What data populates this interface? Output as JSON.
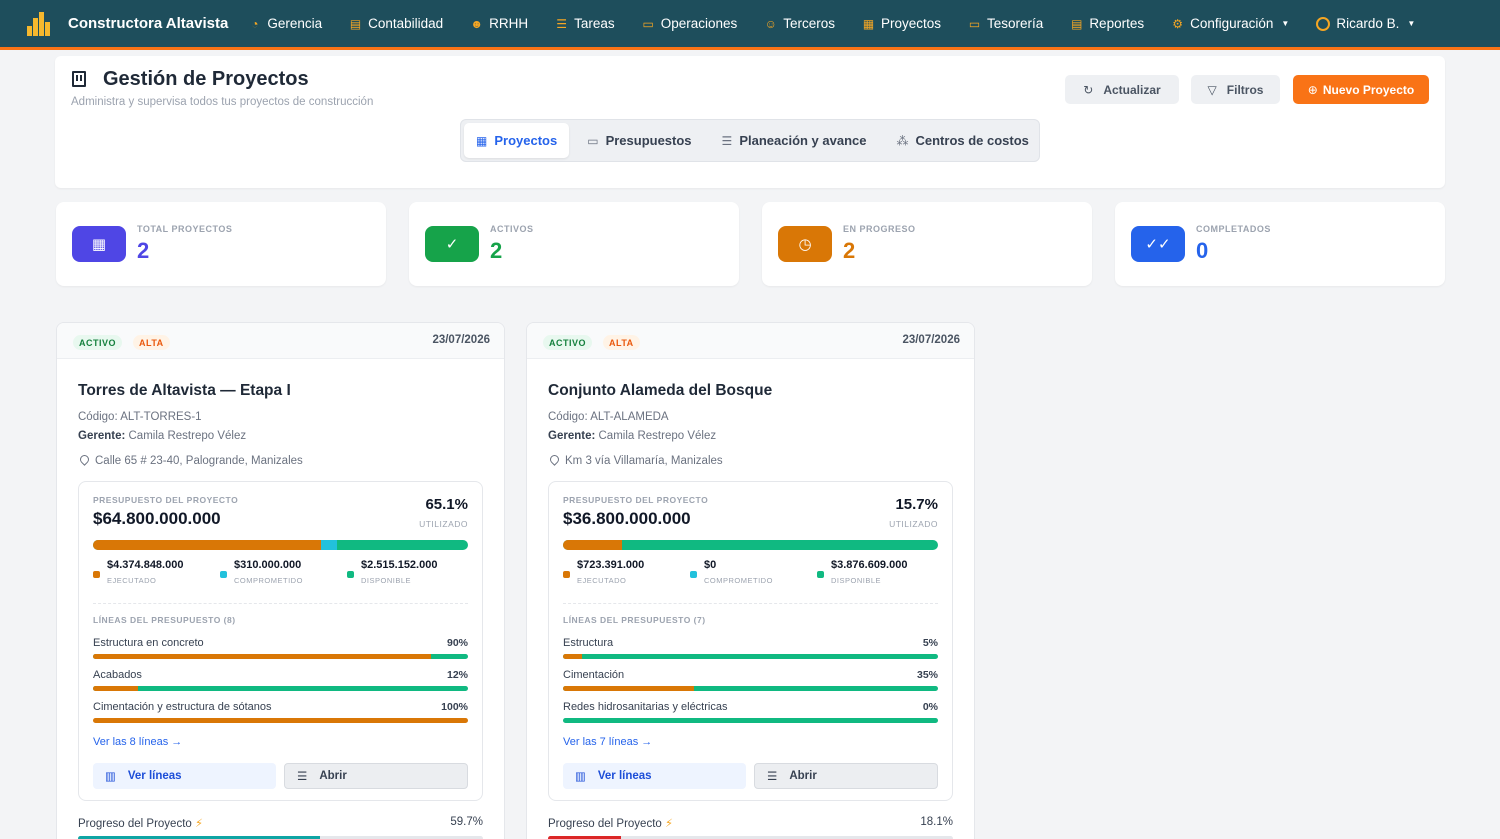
{
  "nav": {
    "brand": "Constructora Altavista",
    "items": [
      {
        "label": "Gerencia",
        "icon": "gauge-icon",
        "glyph": "◔"
      },
      {
        "label": "Contabilidad",
        "icon": "ledger-icon",
        "glyph": "▤"
      },
      {
        "label": "RRHH",
        "icon": "people-icon",
        "glyph": "☻"
      },
      {
        "label": "Tareas",
        "icon": "list-icon",
        "glyph": "☰"
      },
      {
        "label": "Operaciones",
        "icon": "briefcase-icon",
        "glyph": "▭"
      },
      {
        "label": "Terceros",
        "icon": "users-icon",
        "glyph": "☺"
      },
      {
        "label": "Proyectos",
        "icon": "building-icon",
        "glyph": "▦"
      },
      {
        "label": "Tesorería",
        "icon": "card-icon",
        "glyph": "▭"
      },
      {
        "label": "Reportes",
        "icon": "report-icon",
        "glyph": "▤"
      },
      {
        "label": "Configuración",
        "icon": "gear-icon",
        "glyph": "⚙"
      }
    ],
    "user": "Ricardo B."
  },
  "header": {
    "title": "Gestión de Proyectos",
    "subtitle": "Administra y supervisa todos tus proyectos de construcción",
    "btn_refresh": "Actualizar",
    "btn_filters": "Filtros",
    "btn_new": "Nuevo Proyecto"
  },
  "tabs": [
    {
      "label": "Proyectos",
      "glyph": "▦"
    },
    {
      "label": "Presupuestos",
      "glyph": "▭"
    },
    {
      "label": "Planeación y avance",
      "glyph": "☰"
    },
    {
      "label": "Centros de costos",
      "glyph": "⁂"
    }
  ],
  "stats": [
    {
      "label": "TOTAL PROYECTOS",
      "value": "2",
      "color": "#4f46e5"
    },
    {
      "label": "ACTIVOS",
      "value": "2",
      "color": "#16a34a"
    },
    {
      "label": "EN PROGRESO",
      "value": "2",
      "color": "#d97706"
    },
    {
      "label": "COMPLETADOS",
      "value": "0",
      "color": "#2563eb"
    }
  ],
  "colors": {
    "executed": "#d97706",
    "committed": "#22c1dc",
    "available": "#10b981"
  },
  "projects": [
    {
      "status": "ACTIVO",
      "priority": "ALTA",
      "date": "23/07/2026",
      "name": "Torres de Altavista — Etapa I",
      "code": "Código: ALT-TORRES-1",
      "manager_label": "Gerente:",
      "manager": "Camila Restrepo Vélez",
      "address": "Calle 65 # 23-40, Palogrande, Manizales",
      "budget_label": "PRESUPUESTO DEL PROYECTO",
      "budget_total": "$64.800.000.000",
      "utilized_pct": "65.1%",
      "utilized_label": "UTILIZADO",
      "bar": {
        "executed": 0.608,
        "committed": 0.043
      },
      "executed": "$4.374.848.000",
      "executed_label": "EJECUTADO",
      "committed": "$310.000.000",
      "committed_label": "COMPROMETIDO",
      "available": "$2.515.152.000",
      "available_label": "DISPONIBLE",
      "lines_title": "LÍNEAS DEL PRESUPUESTO (8)",
      "lines": [
        {
          "name": "Estructura en concreto",
          "pct": "90%",
          "fill": 0.9
        },
        {
          "name": "Acabados",
          "pct": "12%",
          "fill": 0.12
        },
        {
          "name": "Cimentación y estructura de sótanos",
          "pct": "100%",
          "fill": 1.0
        }
      ],
      "see_all": "Ver las 8 líneas →",
      "btn_lines": "Ver líneas",
      "btn_open": "Abrir",
      "progress_label": "Progreso del Proyecto",
      "progress": "59.7%",
      "progress_fill": 0.597,
      "progress_color": "#0ea5a4"
    },
    {
      "status": "ACTIVO",
      "priority": "ALTA",
      "date": "23/07/2026",
      "name": "Conjunto Alameda del Bosque",
      "code": "Código: ALT-ALAMEDA",
      "manager_label": "Gerente:",
      "manager": "Camila Restrepo Vélez",
      "address": "Km 3 vía Villamaría, Manizales",
      "budget_label": "PRESUPUESTO DEL PROYECTO",
      "budget_total": "$36.800.000.000",
      "utilized_pct": "15.7%",
      "utilized_label": "UTILIZADO",
      "bar": {
        "executed": 0.157,
        "committed": 0.0
      },
      "executed": "$723.391.000",
      "executed_label": "EJECUTADO",
      "committed": "$0",
      "committed_label": "COMPROMETIDO",
      "available": "$3.876.609.000",
      "available_label": "DISPONIBLE",
      "lines_title": "LÍNEAS DEL PRESUPUESTO (7)",
      "lines": [
        {
          "name": "Estructura",
          "pct": "5%",
          "fill": 0.05
        },
        {
          "name": "Cimentación",
          "pct": "35%",
          "fill": 0.35
        },
        {
          "name": "Redes hidrosanitarias y eléctricas",
          "pct": "0%",
          "fill": 0.0
        }
      ],
      "see_all": "Ver las 7 líneas →",
      "btn_lines": "Ver líneas",
      "btn_open": "Abrir",
      "progress_label": "Progreso del Proyecto",
      "progress": "18.1%",
      "progress_fill": 0.181,
      "progress_color": "#dc2626"
    }
  ]
}
